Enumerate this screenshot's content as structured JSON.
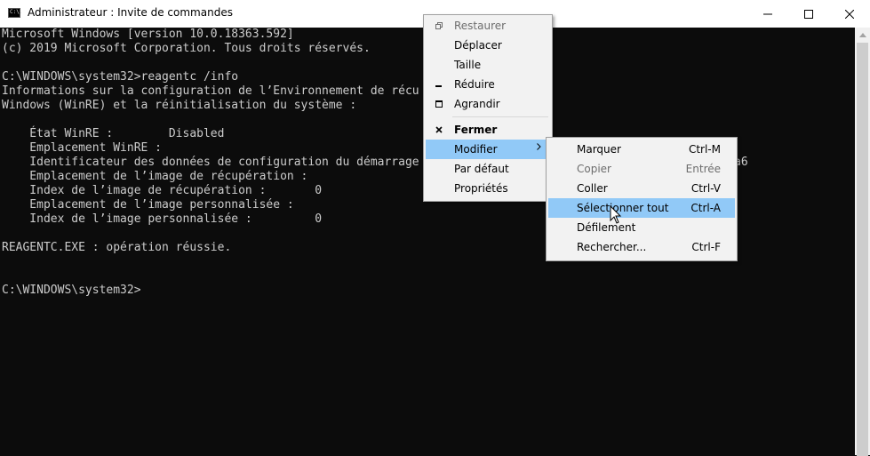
{
  "window": {
    "title": "Administrateur : Invite de commandes",
    "icon_text": "C:\\."
  },
  "terminal": {
    "lines": [
      "Microsoft Windows [version 10.0.18363.592]",
      "(c) 2019 Microsoft Corporation. Tous droits réservés.",
      "",
      "C:\\WINDOWS\\system32>reagentc /info",
      "Informations sur la configuration de l’Environnement de récu",
      "Windows (WinRE) et la réinitialisation du système :",
      "",
      "    État WinRE :        Disabled",
      "    Emplacement WinRE :",
      "    Identificateur des données de configuration du démarrage",
      "    Emplacement de l’image de récupération :",
      "    Index de l’image de récupération :       0",
      "    Emplacement de l’image personnalisée :",
      "    Index de l’image personnalisée :         0",
      "",
      "REAGENTC.EXE : opération réussie.",
      "",
      "",
      "C:\\WINDOWS\\system32>"
    ],
    "overflow_fragment": "a6"
  },
  "system_menu": {
    "items": [
      {
        "label": "Restaurer",
        "icon": "restore-icon",
        "disabled": true
      },
      {
        "label": "Déplacer"
      },
      {
        "label": "Taille"
      },
      {
        "label": "Réduire",
        "icon": "minimize-icon"
      },
      {
        "label": "Agrandir",
        "icon": "maximize-icon"
      },
      {
        "label": "Fermer",
        "icon": "close-icon",
        "bold": true
      },
      {
        "label": "Modifier",
        "submenu": true,
        "highlighted": true
      },
      {
        "label": "Par défaut"
      },
      {
        "label": "Propriétés"
      }
    ]
  },
  "edit_submenu": {
    "items": [
      {
        "label": "Marquer",
        "shortcut": "Ctrl-M"
      },
      {
        "label": "Copier",
        "shortcut": "Entrée",
        "disabled": true
      },
      {
        "label": "Coller",
        "shortcut": "Ctrl-V"
      },
      {
        "label": "Sélectionner tout",
        "shortcut": "Ctrl-A",
        "highlighted": true
      },
      {
        "label": "Défilement",
        "shortcut": ""
      },
      {
        "label": "Rechercher...",
        "shortcut": "Ctrl-F"
      }
    ]
  },
  "colors": {
    "terminal_bg": "#0c0c0c",
    "terminal_fg": "#cccccc",
    "menu_bg": "#f2f2f2",
    "highlight": "#91c9f7"
  }
}
